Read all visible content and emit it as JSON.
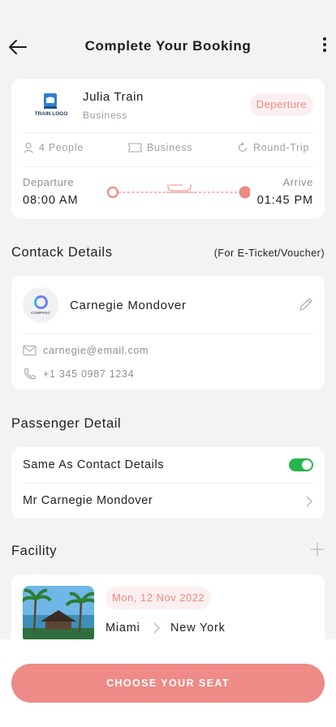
{
  "header": {
    "title": "Complete Your Booking"
  },
  "trip": {
    "logo_text": "TRAIN LOGO",
    "name": "Julia Train",
    "class": "Business",
    "badge": "Deperture",
    "people": "4 People",
    "seat_class": "Business",
    "trip_type": "Round-Trip",
    "departure_label": "Departure",
    "departure_time": "08:00 AM",
    "arrive_label": "Arrive",
    "arrive_time": "01:45 PM"
  },
  "contact": {
    "section_title": "Contack Details",
    "section_note": "(For E-Ticket/Voucher)",
    "avatar_text": "COMPANY",
    "name": "Carnegie Mondover",
    "email": "carnegie@email.com",
    "phone": "+1 345 0987 1234"
  },
  "passenger": {
    "section_title": "Passenger Detail",
    "same_as_contact": "Same As Contact Details",
    "same_as_contact_on": true,
    "passenger_name": "Mr Carnegie Mondover"
  },
  "facility": {
    "section_title": "Facility",
    "date": "Mon, 12 Nov 2022",
    "from": "Miami",
    "to": "New York"
  },
  "footer": {
    "button_label": "CHOOSE YOUR SEAT"
  },
  "colors": {
    "accent": "#ee8b86",
    "badge_bg": "#fbefef",
    "toggle_on": "#27b64b"
  }
}
